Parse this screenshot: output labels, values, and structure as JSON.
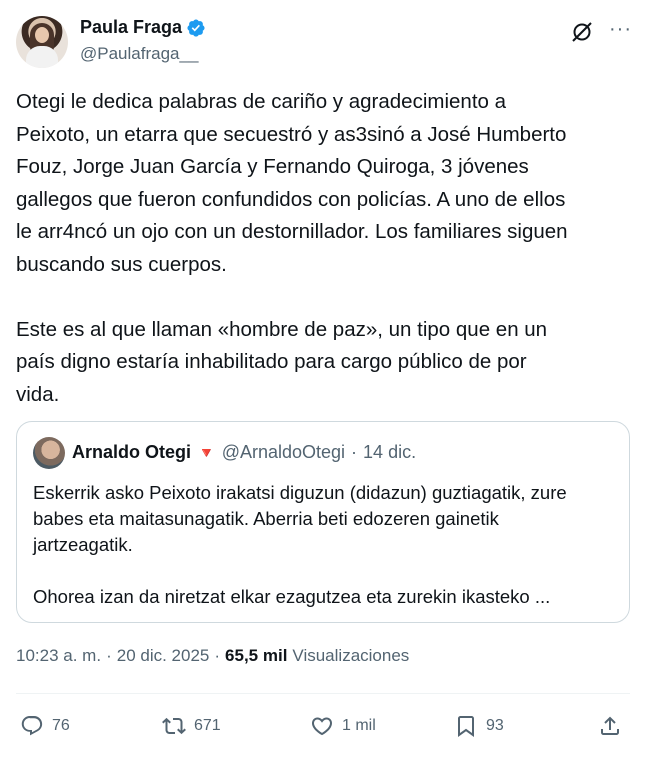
{
  "author": {
    "name": "Paula Fraga",
    "handle": "@Paulafraga__",
    "verified_color": "#1d9bf0"
  },
  "tweet": {
    "text": "Otegi le dedica palabras de cariño y agradecimiento a\nPeixoto, un etarra que secuestró y as3sinó a José Humberto\nFouz, Jorge Juan García y Fernando Quiroga, 3 jóvenes\ngallegos que fueron confundidos con policías. A uno de ellos\nle arr4ncó un ojo con un destornillador. Los familiares siguen\nbuscando sus cuerpos.\n\nEste es al que llaman «hombre de paz», un tipo que en un\npaís digno estaría inhabilitado para cargo público de por\nvida."
  },
  "quote": {
    "name": "Arnaldo Otegi",
    "flag": "🔻",
    "handle": "@ArnaldoOtegi",
    "separator": "·",
    "date": "14 dic.",
    "text": "Eskerrik asko Peixoto irakatsi diguzun (didazun) guztiagatik, zure\nbabes eta maitasunagatik. Aberria beti edozeren gainetik\njartzeagatik.\n\nOhorea izan da niretzat elkar ezagutzea eta zurekin ikasteko ..."
  },
  "meta": {
    "time": "10:23 a. m.",
    "sep": "·",
    "date": "20 dic. 2025",
    "sep2": "·",
    "views_count": "65,5 mil",
    "views_label": "Visualizaciones"
  },
  "actions": {
    "replies": "76",
    "reposts": "671",
    "likes": "1 mil",
    "bookmarks": "93"
  },
  "icons": [
    "verified-icon",
    "grok-icon",
    "more-icon",
    "reply-icon",
    "repost-icon",
    "like-icon",
    "bookmark-icon",
    "share-icon"
  ],
  "colors": {
    "text": "#0f1419",
    "secondary": "#536471",
    "border": "#cfd9de",
    "accent": "#1d9bf0"
  }
}
